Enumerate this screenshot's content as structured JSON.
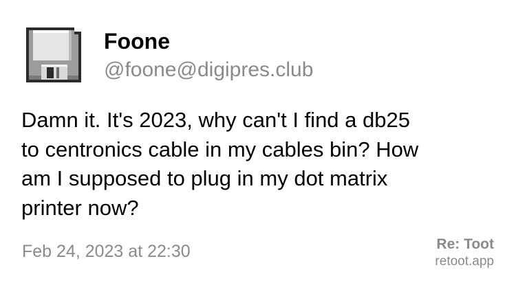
{
  "author": {
    "avatar_icon": "floppy-disk-icon",
    "display_name": "Foone",
    "handle": "@foone@digipres.club"
  },
  "post": {
    "lines": [
      "Damn it. It's 2023, why can't I find a db25",
      "to centronics cable in my cables bin? How",
      "am I supposed to plug in my dot matrix",
      "printer now?"
    ],
    "timestamp": "Feb 24, 2023 at 22:30"
  },
  "branding": {
    "title": "Re: Toot",
    "url": "retoot.app"
  },
  "colors": {
    "text": "#000000",
    "secondary_text": "#8a8a8e",
    "background": "#ffffff"
  }
}
